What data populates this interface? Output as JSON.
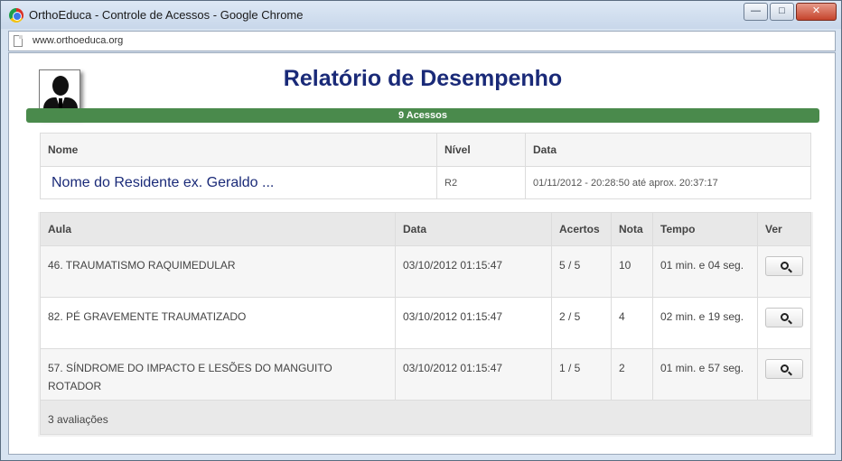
{
  "window": {
    "title": "OrthoEduca - Controle de Acessos - Google Chrome",
    "minimize_glyph": "—",
    "maximize_glyph": "□",
    "close_glyph": "✕"
  },
  "addressbar": {
    "url": "www.orthoeduca.org"
  },
  "page": {
    "title": "Relatório de Desempenho",
    "access_bar": "9 Acessos"
  },
  "info": {
    "headers": {
      "name": "Nome",
      "level": "Nível",
      "date": "Data"
    },
    "name": "Nome do Residente ex. Geraldo ...",
    "level": "R2",
    "date": "01/11/2012 - 20:28:50 até aprox. 20:37:17"
  },
  "lessons": {
    "headers": {
      "lesson": "Aula",
      "date": "Data",
      "correct": "Acertos",
      "grade": "Nota",
      "time": "Tempo",
      "view": "Ver"
    },
    "rows": [
      {
        "lesson": "46. TRAUMATISMO RAQUIMEDULAR",
        "date": "03/10/2012 01:15:47",
        "correct": "5 / 5",
        "grade": "10",
        "time": "01 min. e 04 seg."
      },
      {
        "lesson": "82. PÉ GRAVEMENTE TRAUMATIZADO",
        "date": "03/10/2012 01:15:47",
        "correct": "2 / 5",
        "grade": "4",
        "time": "02 min. e 19 seg."
      },
      {
        "lesson": "57. SÍNDROME DO IMPACTO E LESÕES DO MANGUITO ROTADOR",
        "date": "03/10/2012 01:15:47",
        "correct": "1 / 5",
        "grade": "2",
        "time": "01 min. e 57 seg."
      }
    ],
    "footer": "3 avaliações"
  },
  "icons": {
    "app": "chrome-icon",
    "page": "page-icon",
    "view": "zoom-in-icon",
    "avatar": "user-silhouette"
  }
}
